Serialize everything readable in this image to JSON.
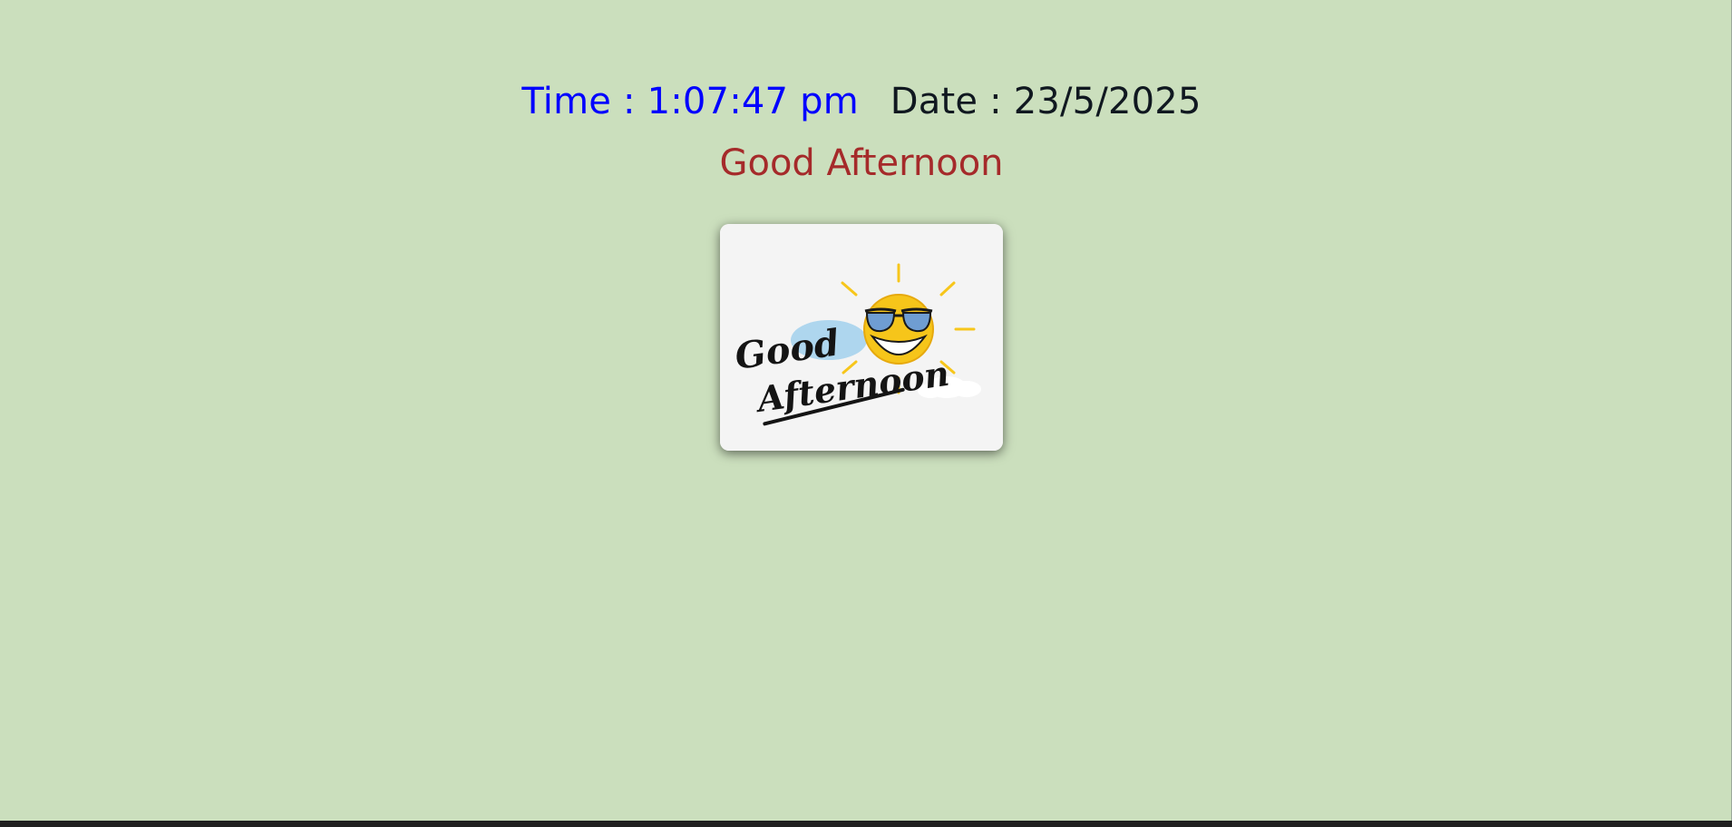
{
  "clock": {
    "time_text": "Time : 1:07:47 pm",
    "date_text": "Date : 23/5/2025"
  },
  "greeting": {
    "text": "Good Afternoon"
  },
  "greeting_image": {
    "line1": "Good",
    "line2": "Afternoon",
    "icon": "sun-with-sunglasses-icon"
  },
  "colors": {
    "background": "#cbdfbd",
    "time": "#0000ff",
    "date": "#101820",
    "greeting": "#a52a2a"
  }
}
